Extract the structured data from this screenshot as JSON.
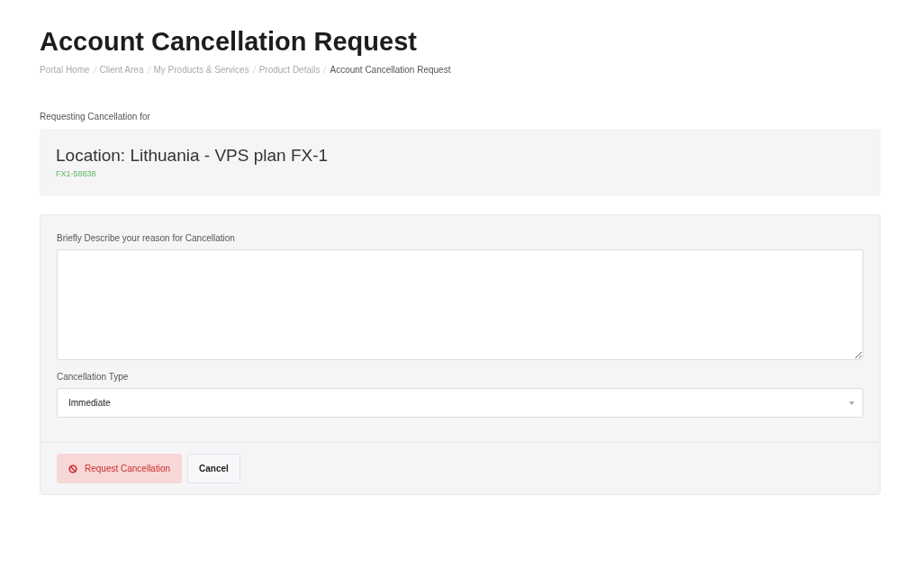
{
  "page_title": "Account Cancellation Request",
  "breadcrumb": [
    {
      "label": "Portal Home",
      "selected": false
    },
    {
      "label": "Client Area",
      "selected": false
    },
    {
      "label": "My Products & Services",
      "selected": false
    },
    {
      "label": "Product Details",
      "selected": false
    },
    {
      "label": "Account Cancellation Request",
      "selected": true
    }
  ],
  "intro": "Requesting Cancellation for",
  "product": {
    "name": "Location: Lithuania - VPS plan FX-1",
    "code": "FX1-58838"
  },
  "form": {
    "reason_label": "Briefly Describe your reason for Cancellation",
    "type_label": "Cancellation Type",
    "type_value": "Immediate"
  },
  "buttons": [
    {
      "label": "Request Cancellation",
      "kind": "danger"
    },
    {
      "label": "Cancel",
      "kind": "default"
    }
  ]
}
